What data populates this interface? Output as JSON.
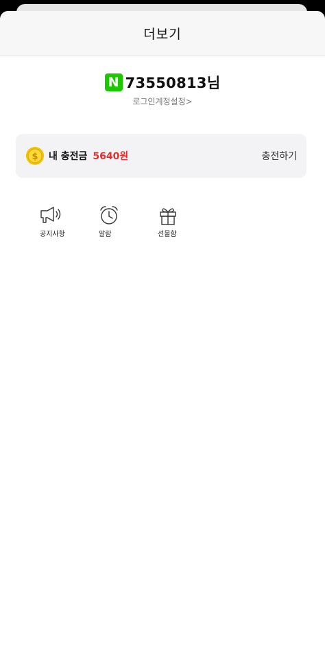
{
  "header": {
    "title": "더보기"
  },
  "profile": {
    "badge_letter": "N",
    "badge_color": "#1ec800",
    "user_name": "73550813님",
    "login_setting_link": "로그인계정설정>"
  },
  "charge": {
    "label": "내 충전금",
    "amount": "5640원",
    "amount_color": "#e03030",
    "charge_button": "충전하기",
    "icon": "coin-icon"
  },
  "menu": {
    "items": [
      {
        "label": "공지사항",
        "icon": "megaphone-icon"
      },
      {
        "label": "알람",
        "icon": "alarm-clock-icon"
      },
      {
        "label": "선물함",
        "icon": "gift-icon"
      }
    ]
  }
}
